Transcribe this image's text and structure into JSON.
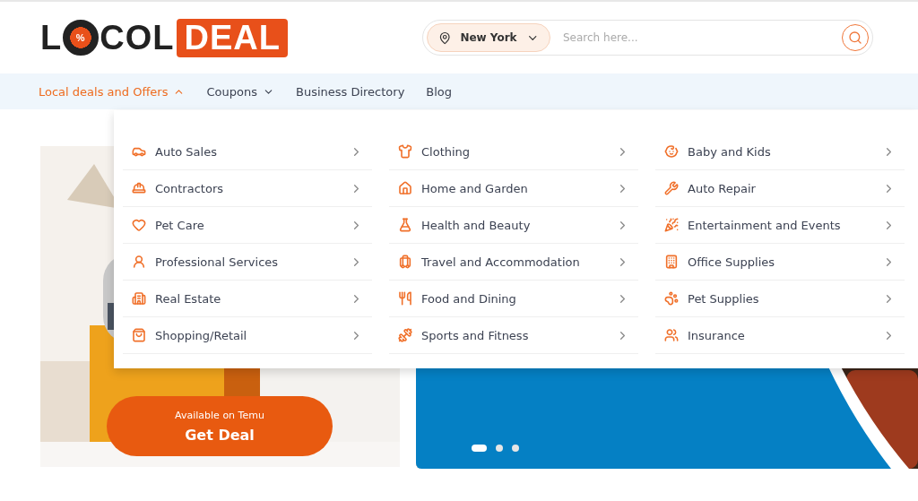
{
  "logo": {
    "prefix": "L",
    "badge": "%",
    "rest": "COL",
    "highlight": "DEAL"
  },
  "search": {
    "location": "New York",
    "placeholder": "Search here..."
  },
  "nav": [
    {
      "label": "Local deals and Offers",
      "kind": "dropdown",
      "expanded": true
    },
    {
      "label": "Coupons",
      "kind": "dropdown",
      "expanded": false
    },
    {
      "label": "Business Directory",
      "kind": "link",
      "expanded": false
    },
    {
      "label": "Blog",
      "kind": "link",
      "expanded": false
    }
  ],
  "menu_columns": [
    [
      "Auto Sales",
      "Contractors",
      "Pet Care",
      "Professional Services",
      "Real Estate",
      "Shopping/Retail"
    ],
    [
      "Clothing",
      "Home and Garden",
      "Health and Beauty",
      "Travel and Accommodation",
      "Food and Dining",
      "Sports and Fitness"
    ],
    [
      "Baby and Kids",
      "Auto Repair",
      "Entertainment and Events",
      "Office Supplies",
      "Pet Supplies",
      "Insurance"
    ]
  ],
  "promo": {
    "kind": "picture",
    "note": "Available on Temu",
    "button": "Get Deal"
  },
  "banner": {
    "kind": "picture",
    "slides": [
      {
        "selected": true
      },
      {
        "selected": false
      },
      {
        "selected": false
      }
    ]
  }
}
